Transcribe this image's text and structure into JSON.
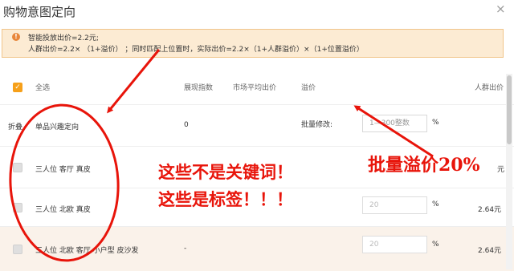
{
  "window": {
    "title": "购物意图定向",
    "close_glyph": "×"
  },
  "notice": {
    "icon": "!",
    "line1": "智能投放出价=2.2元;",
    "line2": "人群出价=2.2× （1+溢价） ；同时匹配上位置时，实际出价=2.2×（1+人群溢价）×（1+位置溢价）"
  },
  "table": {
    "header": {
      "select_all": "全选",
      "impressions": "展现指数",
      "market_avg_bid": "市场平均出价",
      "premium": "溢价",
      "crowd_bid": "人群出价"
    },
    "group_row": {
      "collapse": "折叠",
      "name": "单品兴趣定向",
      "impressions": "0",
      "batch_label": "批量修改:",
      "batch_placeholder": "1—300整数",
      "percent": "%"
    },
    "rows": [
      {
        "name": "三人位 客厅 真皮",
        "impressions": "",
        "premium": "",
        "percent": "",
        "crowd_bid": "元"
      },
      {
        "name": "三人位 北欧 真皮",
        "impressions": "",
        "premium": "20",
        "percent": "%",
        "crowd_bid": "2.64元"
      },
      {
        "name": "三人位 北欧 客厅 小户型 皮沙发",
        "impressions": "-",
        "premium": "20",
        "percent": "%",
        "crowd_bid": "2.64元"
      }
    ]
  },
  "annotations": {
    "line1": "这些不是关键词！",
    "line2": "这些是标签！！！",
    "batch": "批量溢价20%"
  },
  "colors": {
    "accent": "#f6a01a",
    "annotation": "#e8140a",
    "notice_bg": "#fcebd3"
  },
  "icons": {
    "select_all_checkbox": "check-icon",
    "notice": "warning-icon"
  }
}
